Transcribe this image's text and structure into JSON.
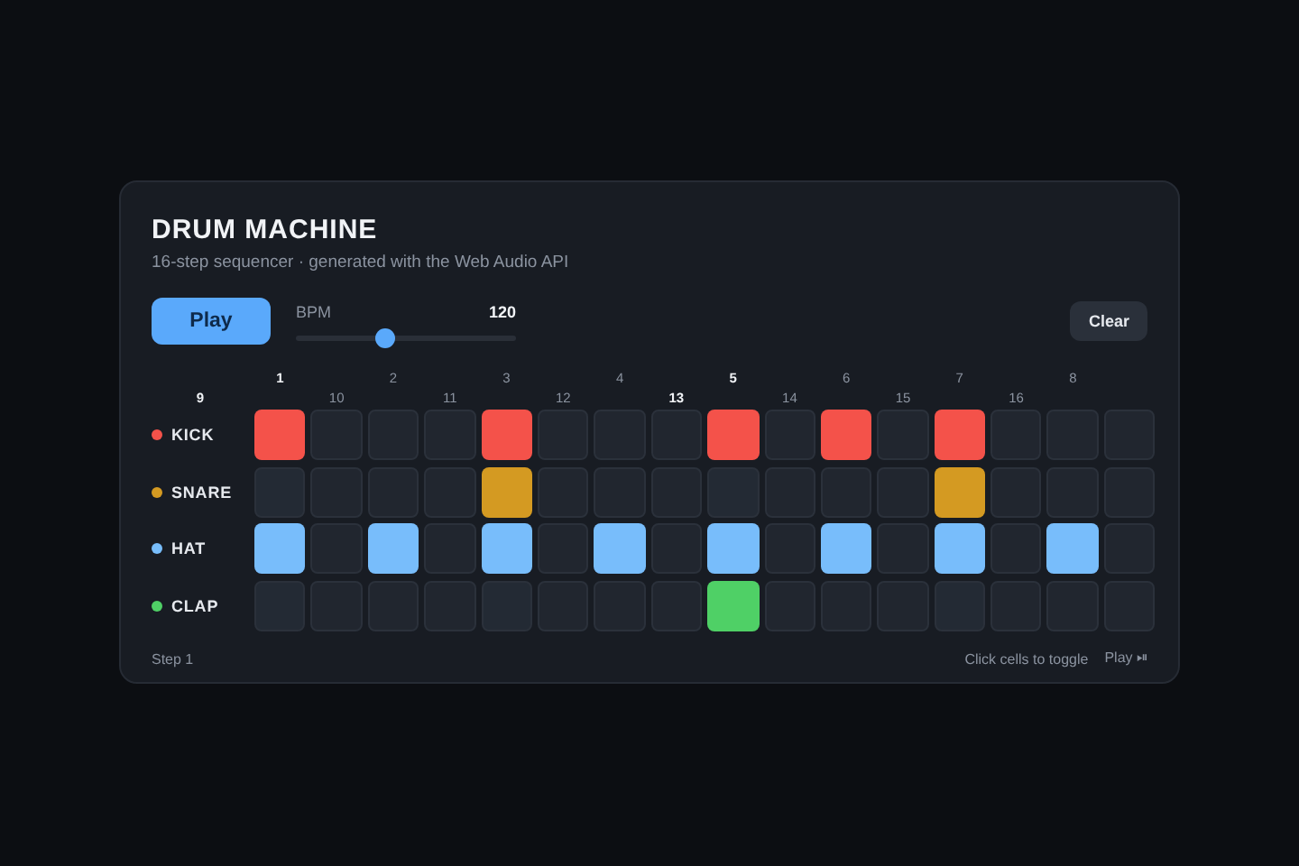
{
  "title": "DRUM MACHINE",
  "subtitle": "16-step sequencer · generated with the Web Audio API",
  "play_button": "Play",
  "bpm": {
    "label": "BPM",
    "reading": "120",
    "level": 0.4
  },
  "clear_button": "Clear",
  "step_labels": [
    {
      "text": "1",
      "accent": true
    },
    {
      "text": "2",
      "accent": false
    },
    {
      "text": "3",
      "accent": false
    },
    {
      "text": "4",
      "accent": false
    },
    {
      "text": "5",
      "accent": true
    },
    {
      "text": "6",
      "accent": false
    },
    {
      "text": "7",
      "accent": false
    },
    {
      "text": "8",
      "accent": false
    },
    {
      "text": "9",
      "accent": true
    },
    {
      "text": "10",
      "accent": false
    },
    {
      "text": "11",
      "accent": false
    },
    {
      "text": "12",
      "accent": false
    },
    {
      "text": "13",
      "accent": true
    },
    {
      "text": "14",
      "accent": false
    },
    {
      "text": "15",
      "accent": false
    },
    {
      "text": "16",
      "accent": false
    }
  ],
  "tracks": [
    {
      "name": "KICK",
      "color": "#f4524a",
      "steps": [
        true,
        false,
        false,
        false,
        true,
        false,
        false,
        false,
        true,
        false,
        true,
        false,
        true,
        false,
        false,
        false
      ]
    },
    {
      "name": "SNARE",
      "color": "#d49a22",
      "steps": [
        false,
        false,
        false,
        false,
        true,
        false,
        false,
        false,
        false,
        false,
        false,
        false,
        true,
        false,
        false,
        false
      ]
    },
    {
      "name": "HAT",
      "color": "#78bdfb",
      "steps": [
        true,
        false,
        true,
        false,
        true,
        false,
        true,
        false,
        true,
        false,
        true,
        false,
        true,
        false,
        true,
        false
      ]
    },
    {
      "name": "CLAP",
      "color": "#4fd066",
      "steps": [
        false,
        false,
        false,
        false,
        false,
        false,
        false,
        false,
        true,
        false,
        false,
        false,
        false,
        false,
        false,
        false
      ]
    }
  ],
  "status": "Step 1",
  "hint": "Click cells to toggle",
  "shortcut": "Play ⏯"
}
